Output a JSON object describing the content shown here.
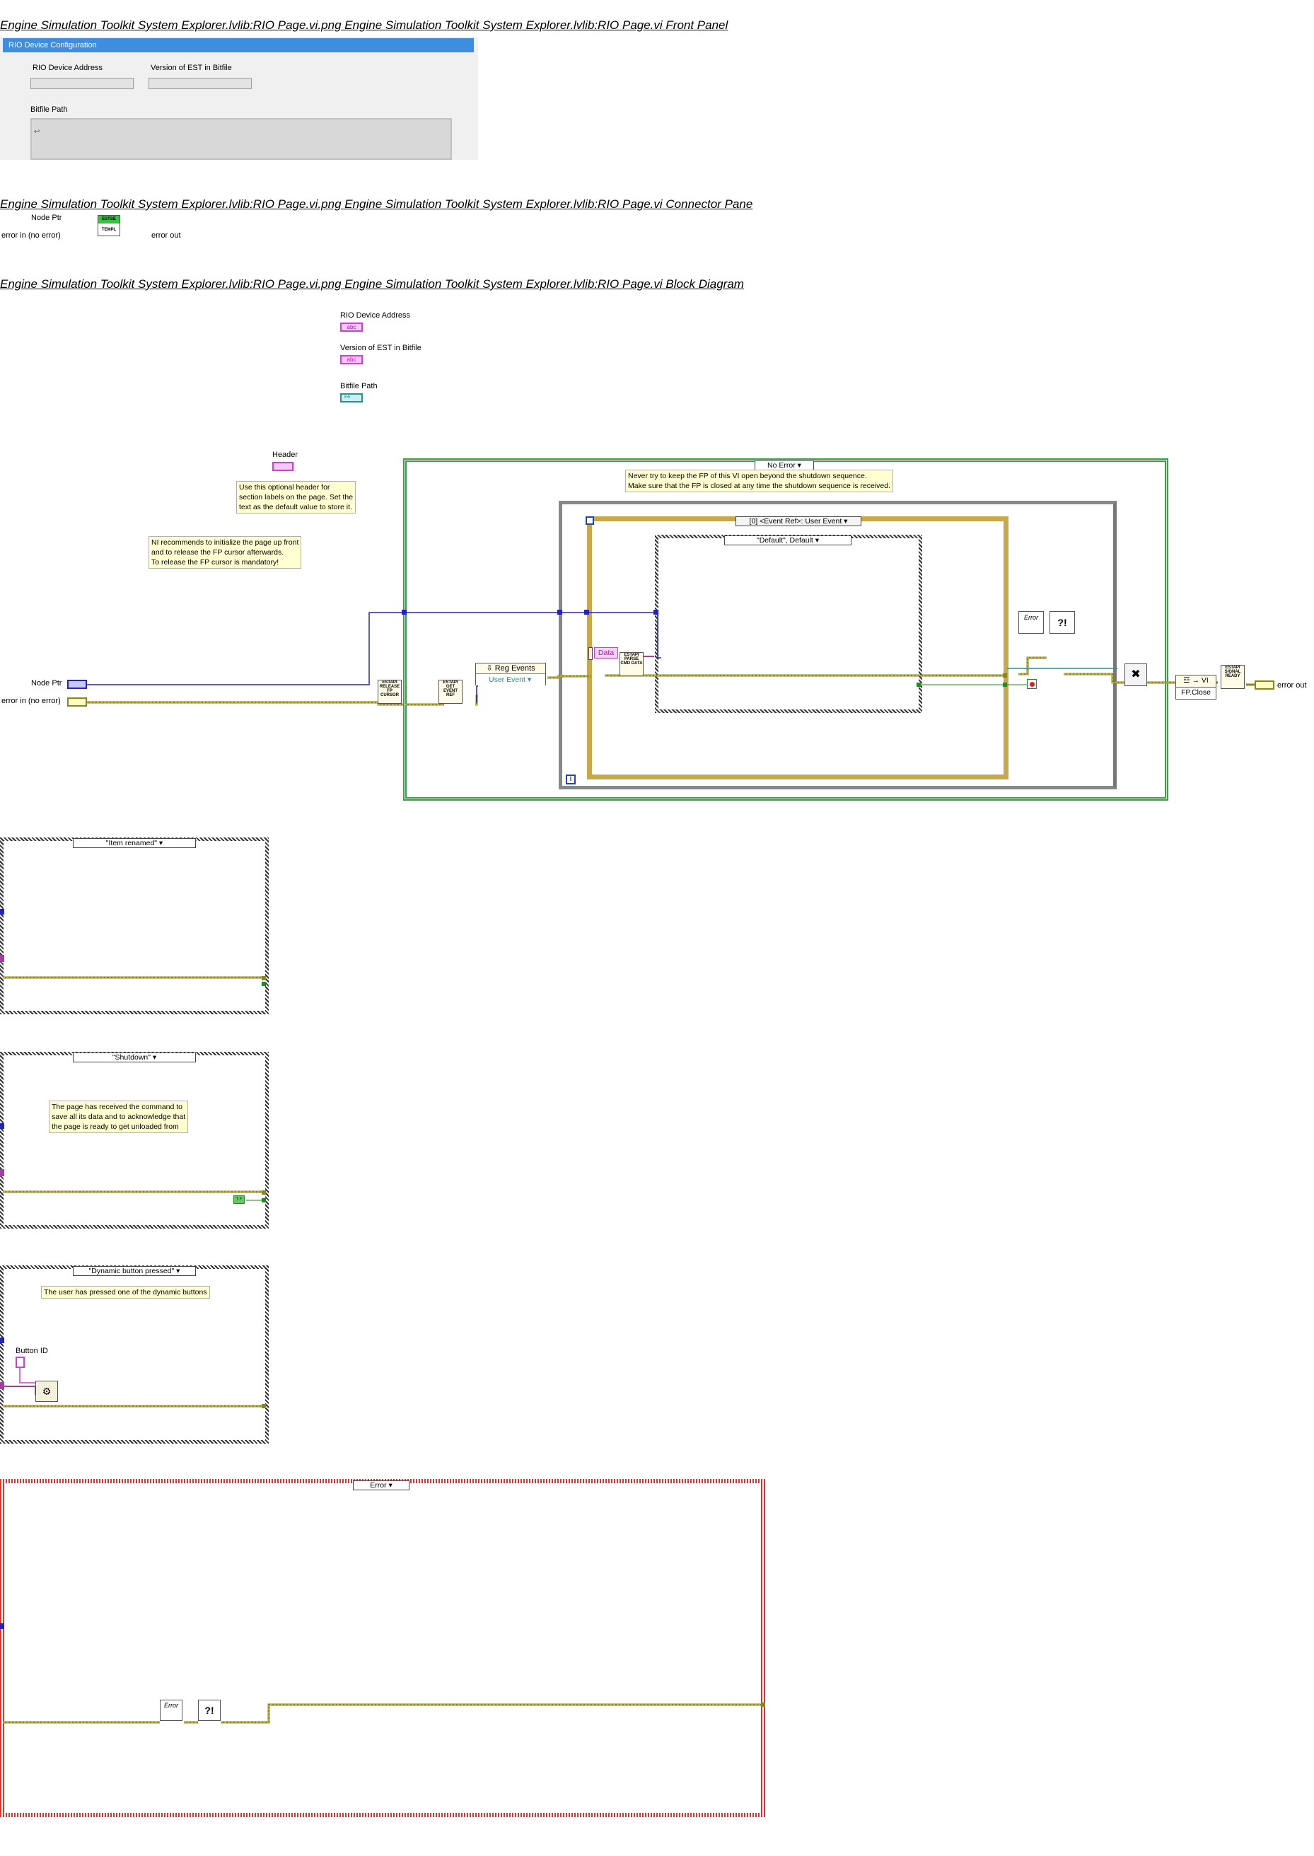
{
  "titles": {
    "front_panel": "Engine Simulation Toolkit System Explorer.lvlib:RIO Page.vi.png  Engine Simulation Toolkit System Explorer.lvlib:RIO Page.vi Front Panel",
    "connector_pane": "Engine Simulation Toolkit System Explorer.lvlib:RIO Page.vi.png  Engine Simulation Toolkit System Explorer.lvlib:RIO Page.vi Connector Pane",
    "block_diagram": "Engine Simulation Toolkit System Explorer.lvlib:RIO Page.vi.png  Engine Simulation Toolkit System Explorer.lvlib:RIO Page.vi Block Diagram"
  },
  "front_panel": {
    "section_header": "RIO Device Configuration",
    "rio_address_label": "RIO Device Address",
    "est_version_label": "Version of EST in Bitfile",
    "bitfile_path_label": "Bitfile Path"
  },
  "connector": {
    "node_ptr": "Node Ptr",
    "error_in": "error in (no error)",
    "error_out": "error out",
    "icon_top": "ESTSE",
    "icon_bottom": "TEMPL"
  },
  "diagram": {
    "indicators": {
      "rio_address": "RIO Device Address",
      "est_version": "Version of EST in Bitfile",
      "bitfile_path": "Bitfile Path",
      "header": "Header",
      "abc": "abc"
    },
    "notes": {
      "header_note": "Use this optional header for\nsection labels on the page. Set the\ntext as the default value to store it.",
      "ni_note": "NI recommends to initialize the page up front\nand to release the FP cursor afterwards.\nTo release the FP cursor is mandatory!",
      "never_note": "Never try to keep the FP of this VI open beyond the shutdown sequence.\nMake sure that the FP is closed at any time the shutdown sequence is received.",
      "shutdown_note": "The page has received the command to\nsave all its data and to acknowledge that\nthe page is ready to get unloaded from",
      "dynamic_note": "The user has pressed one of the dynamic buttons"
    },
    "case_selectors": {
      "no_error": "No Error",
      "event": "[0] <Event Ref>: User Event",
      "default": "\"Default\", Default",
      "item_renamed": "\"Item renamed\"",
      "shutdown": "\"Shutdown\"",
      "dynamic": "\"Dynamic button pressed\"",
      "error": "Error"
    },
    "nodes": {
      "release_fp": "ESTAPI RELEASE FP CURSOR",
      "get_event": "ESTAPI GET EVENT REF",
      "parse_data": "ESTAPI PARSE CMD DATA",
      "signal_ready": "ESTAPI SIGNAL READY",
      "reg_events": "Reg Events",
      "user_event": "User Event",
      "data": "Data",
      "fp_close": "FP.Close",
      "vi": "VI",
      "error_icon": "Error",
      "button_id": "Button ID",
      "node_ptr": "Node Ptr",
      "error_in": "error in (no error)",
      "error_out": "error out",
      "loop_index": "i",
      "true_const": "T F"
    }
  }
}
